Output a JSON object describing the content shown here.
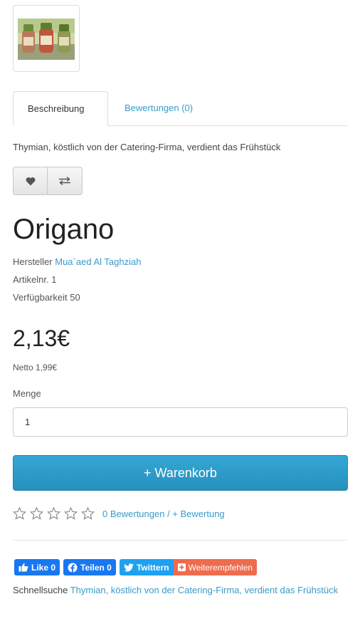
{
  "tabs": [
    {
      "label": "Beschreibung"
    },
    {
      "label": "Bewertungen (0)"
    }
  ],
  "description": "Thymian, köstlich von der Catering-Firma, verdient das Frühstück",
  "icon_buttons": {
    "wishlist_icon": "heart-icon",
    "compare_icon": "compare-arrows-icon"
  },
  "product": {
    "title": "Origano",
    "manufacturer_label": "Hersteller",
    "manufacturer_name": "Mua`aed Al Taghziah",
    "article_label": "Artikelnr.",
    "article_value": "1",
    "availability_label": "Verfügbarkeit",
    "availability_value": "50",
    "price": "2,13€",
    "netto": "Netto 1,99€"
  },
  "quantity": {
    "label": "Menge",
    "value": "1"
  },
  "cart_button": "+ Warenkorb",
  "ratings": {
    "stars": 0,
    "reviews_link": "0 Bewertungen",
    "separator": " / ",
    "add_link": "+ Bewertung"
  },
  "social": {
    "like": "Like 0",
    "share": "Teilen 0",
    "tweet": "Twittern",
    "recommend": "Weiterempfehlen"
  },
  "quicksearch": {
    "label": "Schnellsuche",
    "link": "Thymian, köstlich von der Catering-Firma, verdient das Frühstück"
  },
  "colors": {
    "accent": "#3a9bc9",
    "cart": "#2a9bc8",
    "facebook": "#1877f2",
    "twitter": "#1da1f2",
    "recommend": "#ee6b4d"
  }
}
